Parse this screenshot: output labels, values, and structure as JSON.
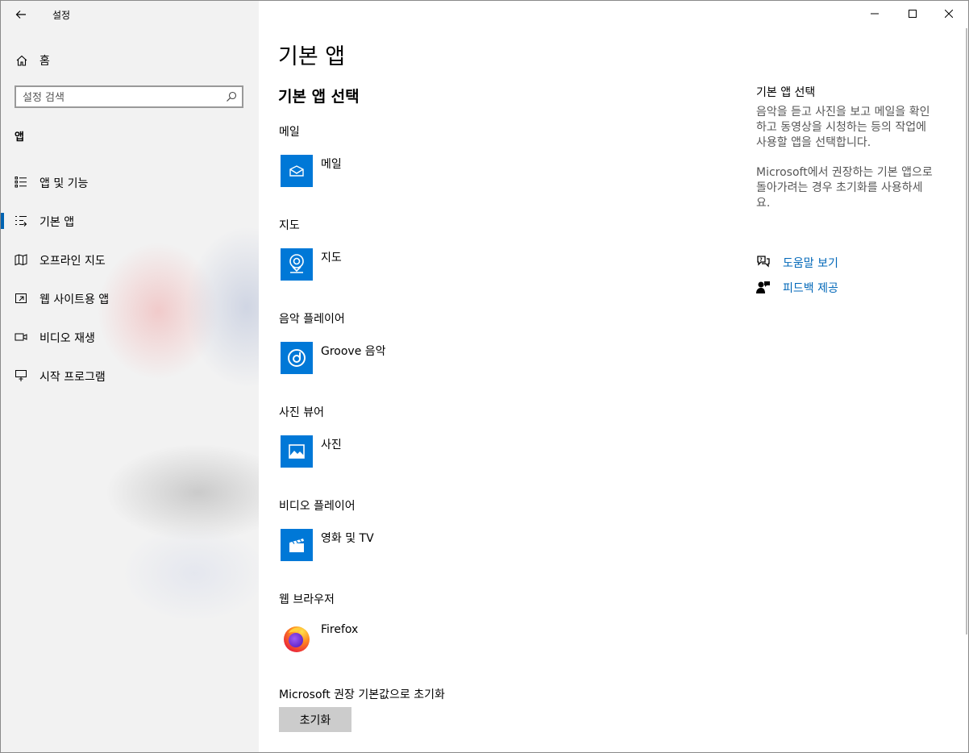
{
  "window": {
    "title": "설정",
    "back_icon": "back-arrow-icon",
    "controls": [
      "minimize-icon",
      "maximize-icon",
      "close-icon"
    ]
  },
  "sidebar": {
    "home_label": "홈",
    "search_placeholder": "설정 검색",
    "section_title": "앱",
    "items": [
      {
        "label": "앱 및 기능",
        "icon": "apps-features-icon",
        "selected": false
      },
      {
        "label": "기본 앱",
        "icon": "default-apps-icon",
        "selected": true
      },
      {
        "label": "오프라인 지도",
        "icon": "offline-maps-icon",
        "selected": false
      },
      {
        "label": "웹 사이트용 앱",
        "icon": "apps-for-websites-icon",
        "selected": false
      },
      {
        "label": "비디오 재생",
        "icon": "video-playback-icon",
        "selected": false
      },
      {
        "label": "시작 프로그램",
        "icon": "startup-icon",
        "selected": false
      }
    ]
  },
  "main": {
    "title": "기본 앱",
    "subtitle": "기본 앱 선택",
    "categories": [
      {
        "label": "메일",
        "app": "메일",
        "icon": "mail-icon"
      },
      {
        "label": "지도",
        "app": "지도",
        "icon": "maps-icon"
      },
      {
        "label": "음악 플레이어",
        "app": "Groove 음악",
        "icon": "groove-music-icon"
      },
      {
        "label": "사진 뷰어",
        "app": "사진",
        "icon": "photos-icon"
      },
      {
        "label": "비디오 플레이어",
        "app": "영화 및 TV",
        "icon": "movies-tv-icon"
      },
      {
        "label": "웹 브라우저",
        "app": "Firefox",
        "icon": "firefox-icon"
      }
    ],
    "reset_label": "Microsoft 권장 기본값으로 초기화",
    "reset_button": "초기화"
  },
  "side": {
    "title": "기본 앱 선택",
    "desc1": [
      "음악을 듣고 사진을 보고 메일을 확인",
      "하고 동영상을 시청하는 등의 작업에",
      "사용할 앱을 선택합니다."
    ],
    "desc2": [
      "Microsoft에서 권장하는 기본 앱으로",
      "돌아가려는 경우 초기화를 사용하세",
      "요."
    ],
    "help_link": "도움말 보기",
    "feedback_link": "피드백 제공"
  },
  "colors": {
    "accent": "#0078d7",
    "link": "#0067b8",
    "sidebar_bg": "#f2f2f2",
    "selection_bar": "#0063b1"
  }
}
